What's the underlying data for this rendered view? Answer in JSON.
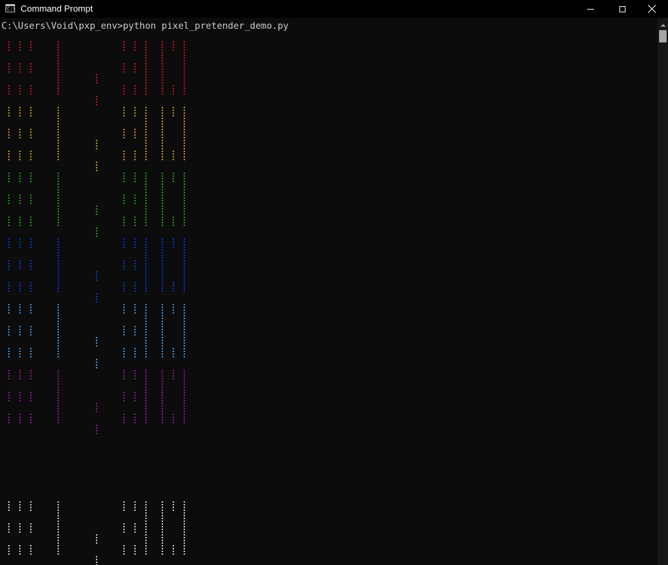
{
  "window": {
    "title": "Command Prompt",
    "icon": "console-icon",
    "icon_text": "C:\\",
    "buttons": {
      "minimize": "minimize-icon",
      "maximize": "maximize-icon",
      "close": "close-icon"
    }
  },
  "console": {
    "prompt_line": "C:\\Users\\Void\\pxp_env>python pixel_pretender_demo.py",
    "text_color": "#cccccc",
    "background": "#0c0c0c"
  },
  "art": {
    "glyph": "▐",
    "rows": [
      {
        "color": "#c50f1f"
      },
      {
        "color": "#c19c00"
      },
      {
        "color": "#13a10e"
      },
      {
        "color": "#0037da"
      },
      {
        "color": "#3a96dd"
      },
      {
        "color": "#881798"
      },
      {
        "color": "#cccccc"
      }
    ]
  }
}
